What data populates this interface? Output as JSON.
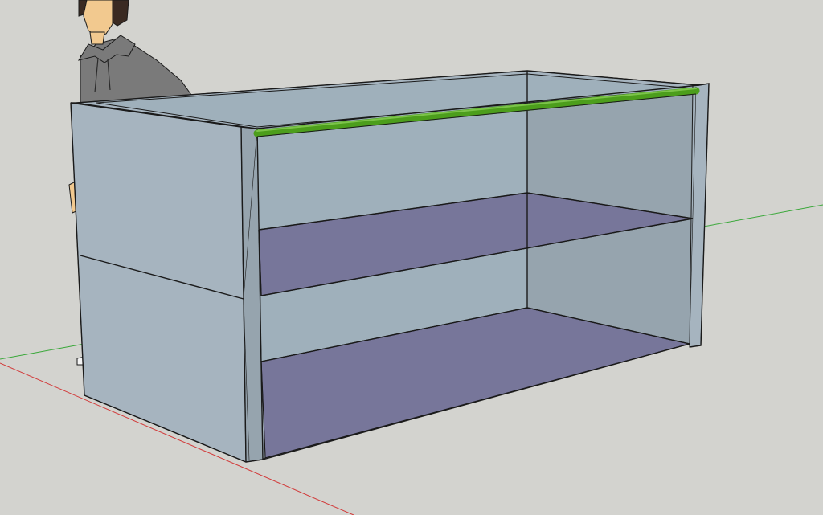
{
  "scene": {
    "background_color": "#d3d3cf",
    "axis_colors": {
      "red_axis": "#d23a3a",
      "green_axis": "#3aa83a"
    },
    "materials": {
      "cabinet_panel": "#a6b4bf",
      "cabinet_panel_shaded": "#96a4ae",
      "inner_back": "#9fb0bb",
      "shelf_top": "#77769a",
      "rod": "#4c9e1c",
      "edge": "#1a1a1a",
      "person_hoodie": "#7a7a7a",
      "person_skin": "#f2c98f",
      "person_hair": "#3a2a22"
    },
    "objects": [
      {
        "name": "scale-figure-person",
        "kind": "component"
      },
      {
        "name": "cabinet-carcass",
        "kind": "group"
      },
      {
        "name": "upper-shelf",
        "kind": "face"
      },
      {
        "name": "bottom-shelf",
        "kind": "face"
      },
      {
        "name": "hanging-rod",
        "kind": "cylinder"
      }
    ]
  }
}
